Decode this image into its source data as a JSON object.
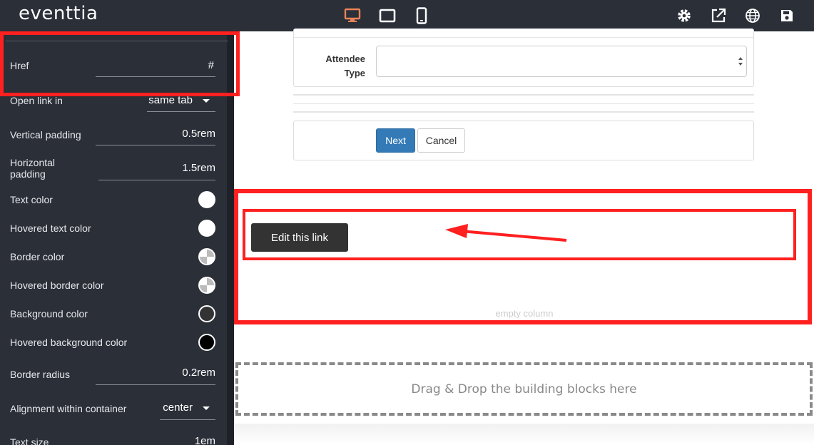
{
  "app": {
    "logo": "eventtia"
  },
  "topbar": {
    "icons": [
      "desktop-icon",
      "tablet-icon",
      "mobile-icon",
      "settings-icon",
      "external-link-icon",
      "globe-icon",
      "save-icon"
    ],
    "active_color": "#e8825a"
  },
  "sidebar": {
    "href_label": "Href",
    "href_value": "#",
    "open_link_label": "Open link in",
    "open_link_value": "same tab",
    "vpad_label": "Vertical padding",
    "vpad_value": "0.5rem",
    "hpad_label": "Horizontal padding",
    "hpad_value": "1.5rem",
    "text_color_label": "Text color",
    "hovered_text_color_label": "Hovered text color",
    "border_color_label": "Border color",
    "hovered_border_color_label": "Hovered border color",
    "bg_color_label": "Background color",
    "hovered_bg_color_label": "Hovered background color",
    "border_radius_label": "Border radius",
    "border_radius_value": "0.2rem",
    "alignment_label": "Alignment within container",
    "alignment_value": "center",
    "text_size_label": "Text size",
    "text_size_value": "1em"
  },
  "form": {
    "attendee_type_label_1": "Attendee",
    "attendee_type_label_2": "Type",
    "next_label": "Next",
    "cancel_label": "Cancel"
  },
  "canvas": {
    "link_button_label": "Edit this link",
    "empty_column_label": "empty column",
    "dropzone_label": "Drag & Drop the building blocks here"
  },
  "colors": {
    "highlight": "#ff2020",
    "primary_button": "#337ab7",
    "dark_button": "#333333"
  }
}
